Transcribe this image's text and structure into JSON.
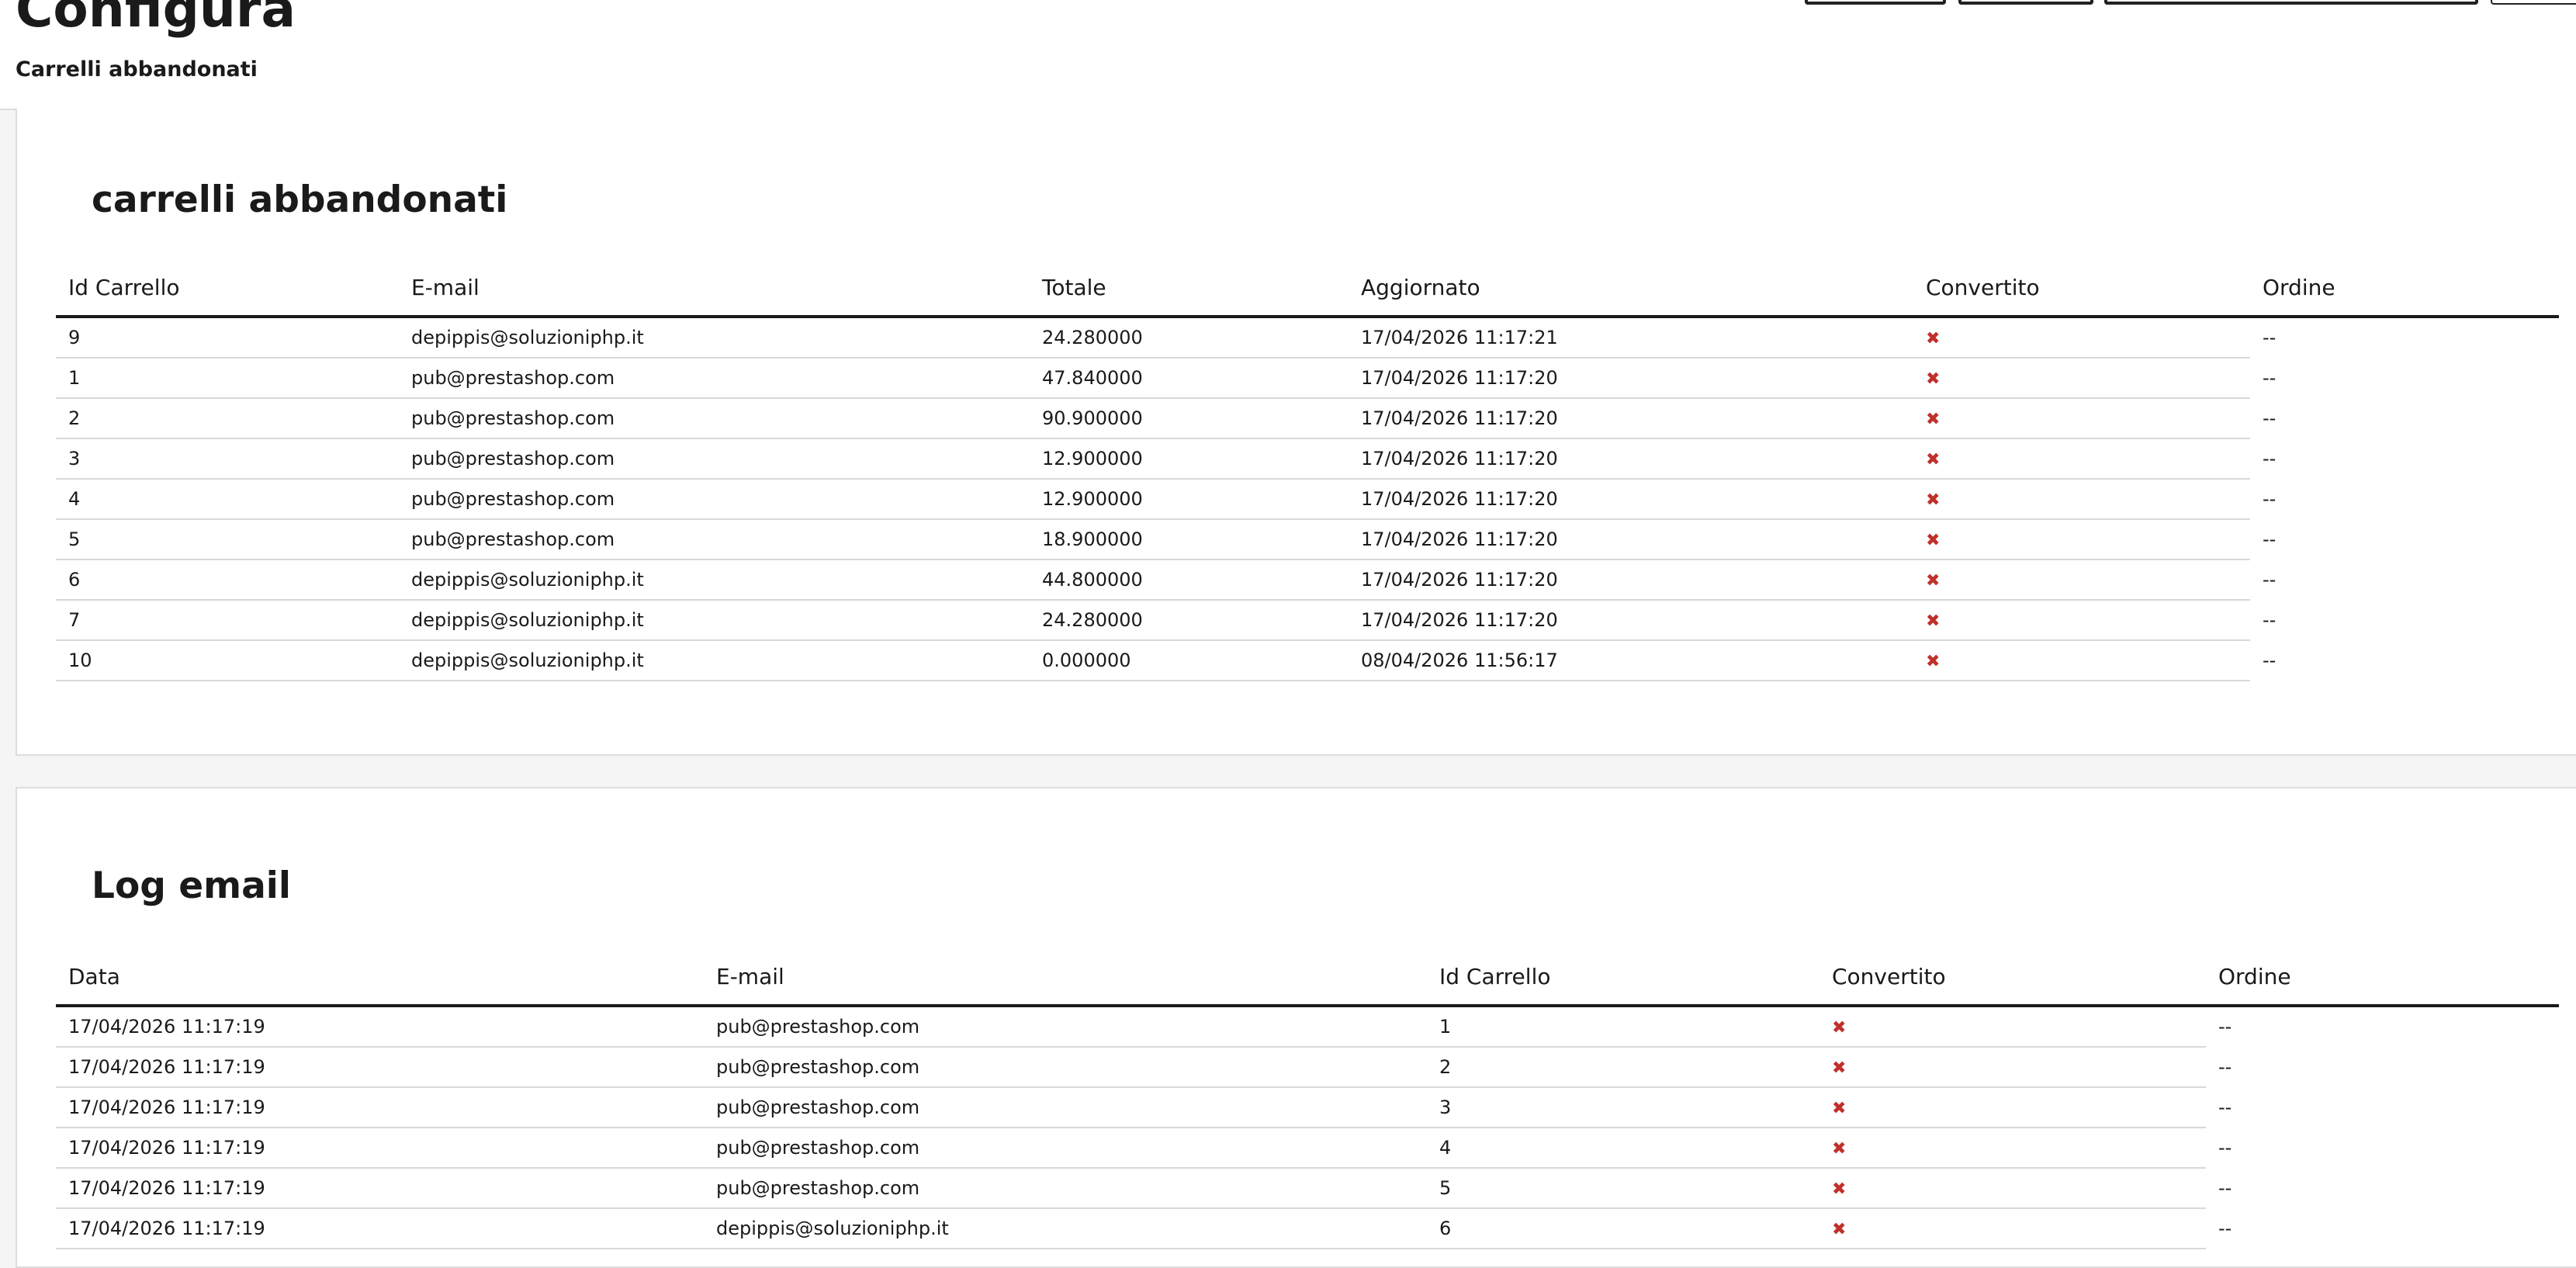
{
  "header": {
    "title": "Configura",
    "breadcrumb": "Carrelli abbandonati"
  },
  "carts": {
    "title": "carrelli abbandonati",
    "columns": [
      "Id Carrello",
      "E-mail",
      "Totale",
      "Aggiornato",
      "Convertito",
      "Ordine"
    ],
    "rows": [
      [
        "9",
        "depippis@soluzioniphp.it",
        "24.280000",
        "17/04/2026 11:17:21",
        "✖",
        "--"
      ],
      [
        "1",
        "pub@prestashop.com",
        "47.840000",
        "17/04/2026 11:17:20",
        "✖",
        "--"
      ],
      [
        "2",
        "pub@prestashop.com",
        "90.900000",
        "17/04/2026 11:17:20",
        "✖",
        "--"
      ],
      [
        "3",
        "pub@prestashop.com",
        "12.900000",
        "17/04/2026 11:17:20",
        "✖",
        "--"
      ],
      [
        "4",
        "pub@prestashop.com",
        "12.900000",
        "17/04/2026 11:17:20",
        "✖",
        "--"
      ],
      [
        "5",
        "pub@prestashop.com",
        "18.900000",
        "17/04/2026 11:17:20",
        "✖",
        "--"
      ],
      [
        "6",
        "depippis@soluzioniphp.it",
        "44.800000",
        "17/04/2026 11:17:20",
        "✖",
        "--"
      ],
      [
        "7",
        "depippis@soluzioniphp.it",
        "24.280000",
        "17/04/2026 11:17:20",
        "✖",
        "--"
      ],
      [
        "10",
        "depippis@soluzioniphp.it",
        "0.000000",
        "08/04/2026 11:56:17",
        "✖",
        "--"
      ]
    ]
  },
  "log": {
    "title": "Log email",
    "columns": [
      "Data",
      "E-mail",
      "Id Carrello",
      "Convertito",
      "Ordine"
    ],
    "rows": [
      [
        "17/04/2026 11:17:19",
        "pub@prestashop.com",
        "1",
        "✖",
        "--"
      ],
      [
        "17/04/2026 11:17:19",
        "pub@prestashop.com",
        "2",
        "✖",
        "--"
      ],
      [
        "17/04/2026 11:17:19",
        "pub@prestashop.com",
        "3",
        "✖",
        "--"
      ],
      [
        "17/04/2026 11:17:19",
        "pub@prestashop.com",
        "4",
        "✖",
        "--"
      ],
      [
        "17/04/2026 11:17:19",
        "pub@prestashop.com",
        "5",
        "✖",
        "--"
      ],
      [
        "17/04/2026 11:17:19",
        "depippis@soluzioniphp.it",
        "6",
        "✖",
        "--"
      ]
    ]
  },
  "colors": {
    "not_converted": "#c0302b",
    "header_rule": "#1a1a1a",
    "row_rule": "#d8d8d8"
  },
  "icons": {
    "not_converted": "cross-icon"
  }
}
